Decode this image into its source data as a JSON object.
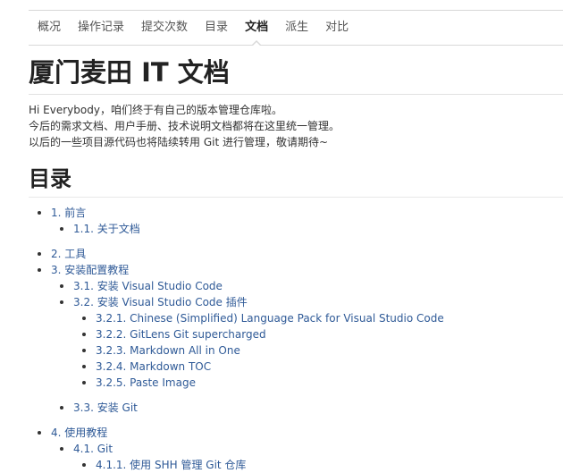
{
  "nav": {
    "tabs": [
      {
        "label": "概况"
      },
      {
        "label": "操作记录"
      },
      {
        "label": "提交次数"
      },
      {
        "label": "目录"
      },
      {
        "label": "文档"
      },
      {
        "label": "派生"
      },
      {
        "label": "对比"
      }
    ],
    "active_tab": "文档"
  },
  "doc": {
    "title": "厦门麦田 IT 文档",
    "intro": [
      "Hi Everybody，咱们终于有自己的版本管理仓库啦。",
      "今后的需求文档、用户手册、技术说明文档都将在这里统一管理。",
      "以后的一些项目源代码也将陆续转用 Git 进行管理，敬请期待~"
    ],
    "toc_title": "目录",
    "toc": [
      {
        "label": "1. 前言"
      },
      {
        "label": "1.1. 关于文档"
      },
      {
        "label": "2. 工具"
      },
      {
        "label": "3. 安装配置教程"
      },
      {
        "label": "3.1. 安装 Visual Studio Code"
      },
      {
        "label": "3.2. 安装 Visual Studio Code 插件"
      },
      {
        "label": "3.2.1. Chinese (Simplified) Language Pack for Visual Studio Code"
      },
      {
        "label": "3.2.2. GitLens Git supercharged"
      },
      {
        "label": "3.2.3. Markdown All in One"
      },
      {
        "label": "3.2.4. Markdown TOC"
      },
      {
        "label": "3.2.5. Paste Image"
      },
      {
        "label": "3.3. 安装 Git"
      },
      {
        "label": "4. 使用教程"
      },
      {
        "label": "4.1. Git"
      },
      {
        "label": "4.1.1. 使用 SHH 管理 Git 仓库"
      }
    ]
  },
  "colors": {
    "link": "#2f5a97",
    "text": "#333333",
    "border": "#d8d8d8"
  }
}
